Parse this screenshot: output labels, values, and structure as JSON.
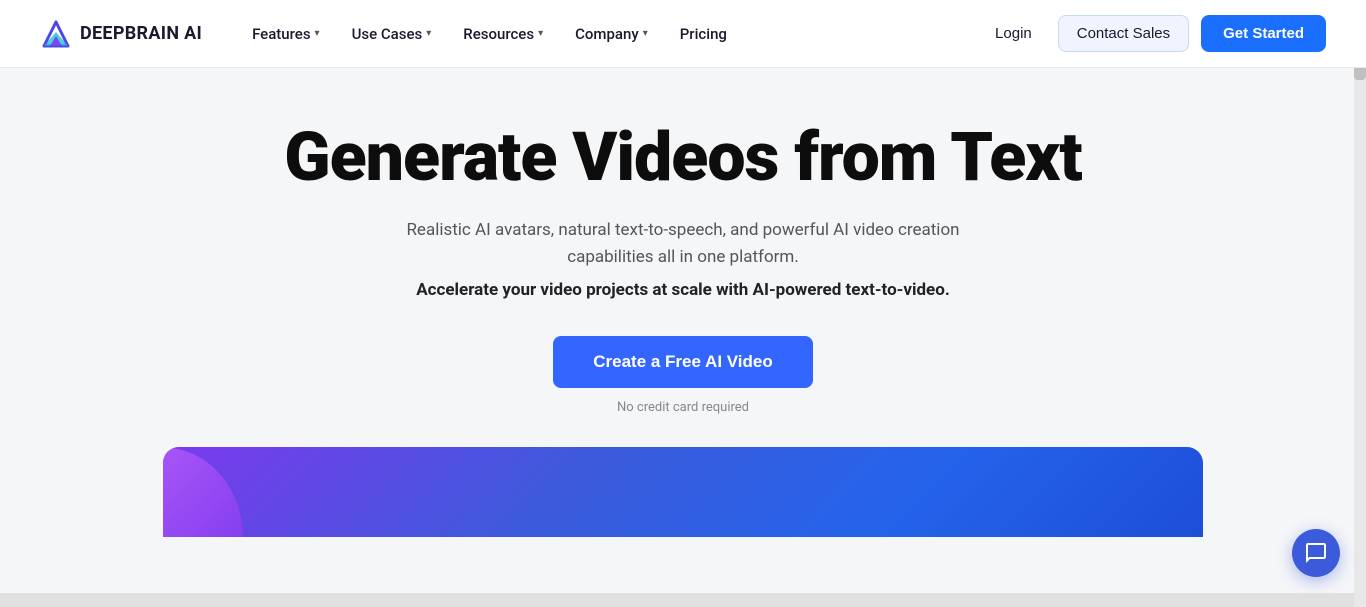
{
  "brand": {
    "name": "DEEPBRAIN AI",
    "logo_alt": "DeepBrain AI Logo"
  },
  "navbar": {
    "features_label": "Features",
    "use_cases_label": "Use Cases",
    "resources_label": "Resources",
    "company_label": "Company",
    "pricing_label": "Pricing",
    "login_label": "Login",
    "contact_sales_label": "Contact Sales",
    "get_started_label": "Get Started"
  },
  "hero": {
    "title": "Generate Videos from Text",
    "subtitle": "Realistic AI avatars, natural text-to-speech, and powerful AI video creation capabilities all in one platform.",
    "subtitle_bold": "Accelerate your video projects at scale with AI-powered text-to-video.",
    "cta_label": "Create a Free AI Video",
    "no_credit_label": "No credit card required"
  },
  "colors": {
    "accent_blue": "#3366ff",
    "nav_bg": "#ffffff",
    "hero_bg": "#f5f6f8",
    "get_started_bg": "#1a6fff",
    "contact_sales_bg": "#f0f4ff"
  }
}
